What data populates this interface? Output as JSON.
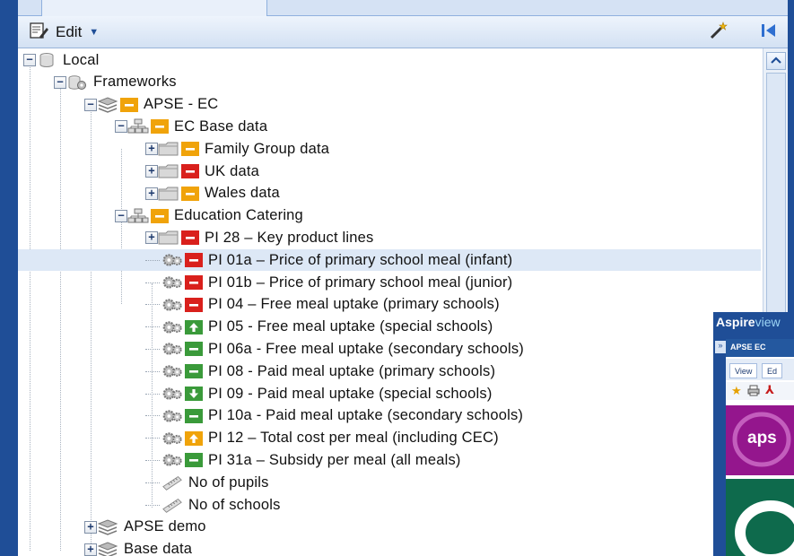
{
  "toolbar": {
    "edit_label": "Edit",
    "edit_icon": "edit-document-icon",
    "right_icons": [
      "magic-wand-icon",
      "collapse-panel-icon"
    ]
  },
  "tree": {
    "rows": [
      {
        "label": "Local",
        "depth": 0,
        "expander": "−",
        "icon": "database-icon",
        "status": null
      },
      {
        "label": "Frameworks",
        "depth": 1,
        "expander": "−",
        "icon": "framework-database-icon",
        "status": null
      },
      {
        "label": "APSE - EC",
        "depth": 2,
        "expander": "−",
        "icon": "stack-icon",
        "status": "amber-dash"
      },
      {
        "label": "EC Base data",
        "depth": 3,
        "expander": "−",
        "icon": "hierarchy-icon",
        "status": "amber-dash"
      },
      {
        "label": "Family Group data",
        "depth": 4,
        "expander": "+",
        "icon": "folder-icon",
        "status": "amber-dash"
      },
      {
        "label": "UK data",
        "depth": 4,
        "expander": "+",
        "icon": "folder-icon",
        "status": "red-dash"
      },
      {
        "label": "Wales data",
        "depth": 4,
        "expander": "+",
        "icon": "folder-icon",
        "status": "amber-dash"
      },
      {
        "label": "Education Catering",
        "depth": 3,
        "expander": "−",
        "icon": "hierarchy-icon",
        "status": "amber-dash"
      },
      {
        "label": "PI 28 – Key product lines",
        "depth": 4,
        "expander": "+",
        "icon": "folder-icon",
        "status": "red-dash"
      },
      {
        "label": "PI 01a – Price of primary school meal (infant)",
        "depth": 4,
        "expander": null,
        "icon": "gears-icon",
        "status": "red-dash",
        "selected": true
      },
      {
        "label": "PI 01b – Price of primary school meal (junior)",
        "depth": 4,
        "expander": null,
        "icon": "gears-icon",
        "status": "red-dash"
      },
      {
        "label": "PI 04 – Free meal uptake (primary schools)",
        "depth": 4,
        "expander": null,
        "icon": "gears-icon",
        "status": "red-dash"
      },
      {
        "label": "PI 05 - Free meal uptake (special schools)",
        "depth": 4,
        "expander": null,
        "icon": "gears-icon",
        "status": "green-up"
      },
      {
        "label": "PI 06a - Free meal uptake (secondary schools)",
        "depth": 4,
        "expander": null,
        "icon": "gears-icon",
        "status": "green-dash"
      },
      {
        "label": "PI 08 - Paid meal uptake (primary schools)",
        "depth": 4,
        "expander": null,
        "icon": "gears-icon",
        "status": "green-dash"
      },
      {
        "label": "PI 09 - Paid meal uptake (special schools)",
        "depth": 4,
        "expander": null,
        "icon": "gears-icon",
        "status": "green-down"
      },
      {
        "label": "PI 10a - Paid meal uptake (secondary schools)",
        "depth": 4,
        "expander": null,
        "icon": "gears-icon",
        "status": "green-dash"
      },
      {
        "label": "PI 12 – Total cost per meal (including CEC)",
        "depth": 4,
        "expander": null,
        "icon": "gears-icon",
        "status": "amber-up"
      },
      {
        "label": "PI 31a – Subsidy per meal (all meals)",
        "depth": 4,
        "expander": null,
        "icon": "gears-icon",
        "status": "green-dash"
      },
      {
        "label": "No of pupils",
        "depth": 4,
        "expander": null,
        "icon": "ruler-icon",
        "status": null
      },
      {
        "label": "No of schools",
        "depth": 4,
        "expander": null,
        "icon": "ruler-icon",
        "status": null
      },
      {
        "label": "APSE demo",
        "depth": 2,
        "expander": "+",
        "icon": "stack-icon",
        "status": null
      },
      {
        "label": "Base data",
        "depth": 2,
        "expander": "+",
        "icon": "stack-icon",
        "status": null
      }
    ]
  },
  "status_colors": {
    "red": "#d9201c",
    "amber": "#f0a30a",
    "green": "#3a9a3a"
  },
  "aspire_window": {
    "brand_a": "Aspire",
    "brand_b": "view",
    "title": "APSE EC",
    "side_btn": "»",
    "tabs": [
      "View",
      "Ed"
    ],
    "tile_text": "aps"
  }
}
